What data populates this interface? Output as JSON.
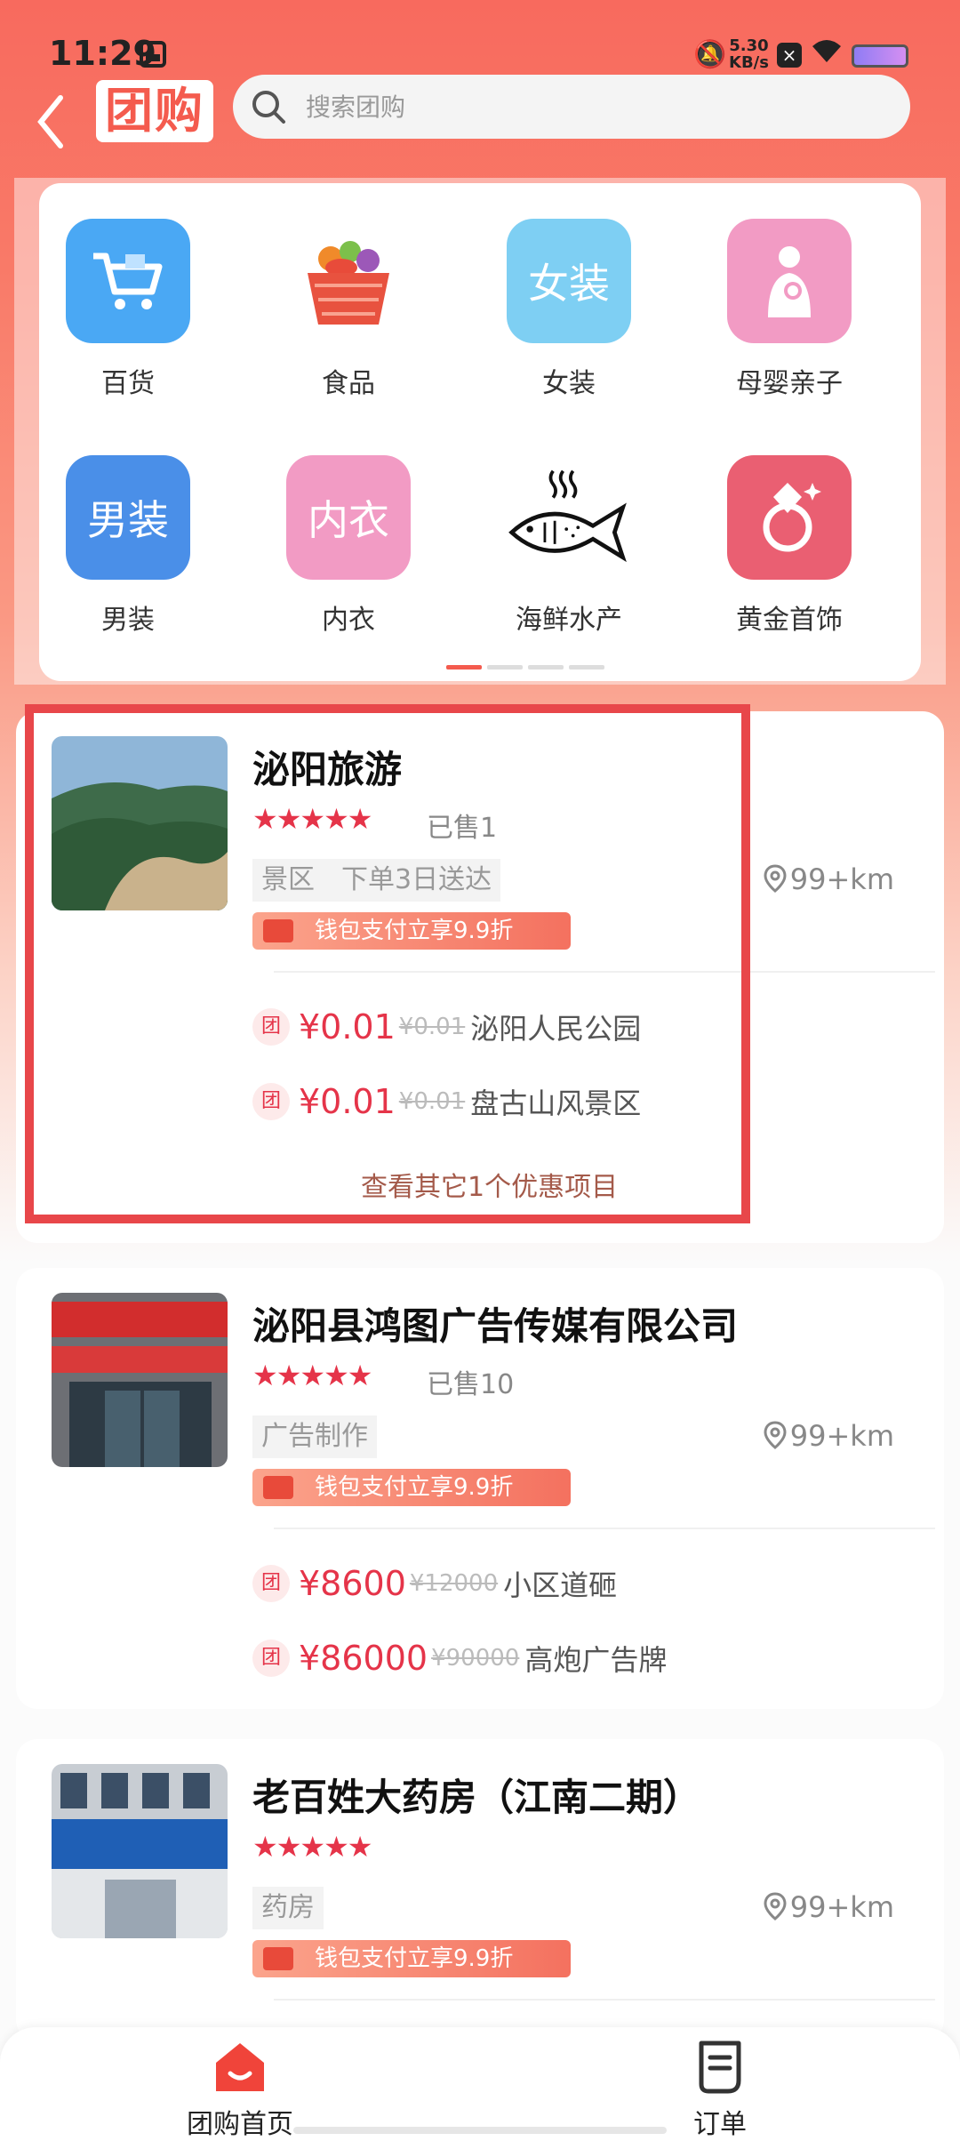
{
  "status": {
    "time": "11:29",
    "speed_top": "5.30",
    "speed_bottom": "KB/s"
  },
  "header": {
    "logo": "团购",
    "search_placeholder": "搜索团购"
  },
  "categories": [
    {
      "label": "百货",
      "icon": "shopping-cart-icon",
      "color": "#4aa8f4",
      "text": ""
    },
    {
      "label": "食品",
      "icon": "food-basket-icon",
      "color": "#ffffff",
      "text": ""
    },
    {
      "label": "女装",
      "icon": "womens-clothing-icon",
      "color": "#7ecff3",
      "text": "女装"
    },
    {
      "label": "母婴亲子",
      "icon": "mother-baby-icon",
      "color": "#f29bc4",
      "text": ""
    },
    {
      "label": "男装",
      "icon": "mens-clothing-icon",
      "color": "#4a8fe8",
      "text": "男装"
    },
    {
      "label": "内衣",
      "icon": "underwear-icon",
      "color": "#f29bc4",
      "text": "内衣"
    },
    {
      "label": "海鲜水产",
      "icon": "fish-icon",
      "color": "#ffffff",
      "text": ""
    },
    {
      "label": "黄金首饰",
      "icon": "diamond-ring-icon",
      "color": "#ea5f72",
      "text": ""
    }
  ],
  "stores": [
    {
      "title": "泌阳旅游",
      "sold": "已售1",
      "tags": [
        "景区",
        "下单3日送达"
      ],
      "distance": "99+km",
      "promo": "钱包支付立享9.9折",
      "deals": [
        {
          "badge": "团",
          "price": "¥0.01",
          "orig": "¥0.01",
          "name": "泌阳人民公园"
        },
        {
          "badge": "团",
          "price": "¥0.01",
          "orig": "¥0.01",
          "name": "盘古山风景区"
        }
      ],
      "more": "查看其它1个优惠项目"
    },
    {
      "title": "泌阳县鸿图广告传媒有限公司",
      "sold": "已售10",
      "tags": [
        "广告制作"
      ],
      "distance": "99+km",
      "promo": "钱包支付立享9.9折",
      "deals": [
        {
          "badge": "团",
          "price": "¥8600",
          "orig": "¥12000",
          "name": "小区道砸"
        },
        {
          "badge": "团",
          "price": "¥86000",
          "orig": "¥90000",
          "name": "高炮广告牌"
        }
      ]
    },
    {
      "title": "老百姓大药房（江南二期）",
      "sold": "",
      "tags": [
        "药房"
      ],
      "distance": "99+km",
      "promo": "钱包支付立享9.9折",
      "deals": []
    }
  ],
  "nav": {
    "home": "团购首页",
    "orders": "订单"
  }
}
